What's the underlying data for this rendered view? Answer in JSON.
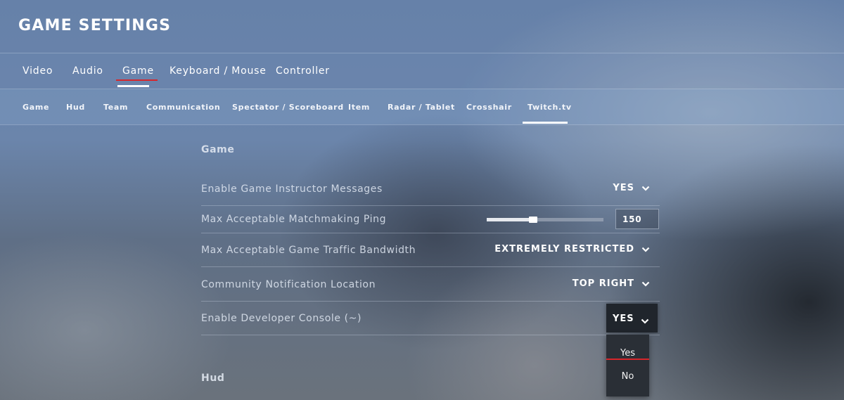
{
  "header": {
    "title": "GAME SETTINGS"
  },
  "main_tabs": [
    {
      "label": "Video"
    },
    {
      "label": "Audio"
    },
    {
      "label": "Game",
      "selected": true
    },
    {
      "label": "Keyboard / Mouse"
    },
    {
      "label": "Controller"
    }
  ],
  "sub_tabs": [
    {
      "label": "Game"
    },
    {
      "label": "Hud"
    },
    {
      "label": "Team"
    },
    {
      "label": "Communication"
    },
    {
      "label": "Spectator / Scoreboard"
    },
    {
      "label": "Item"
    },
    {
      "label": "Radar / Tablet"
    },
    {
      "label": "Crosshair"
    },
    {
      "label": "Twitch.tv",
      "selected": true
    }
  ],
  "sections": {
    "game": {
      "heading": "Game",
      "rows": [
        {
          "label": "Enable Game Instructor Messages",
          "value": "YES"
        },
        {
          "label": "Max Acceptable Matchmaking Ping",
          "value": "150",
          "slider_fraction": 0.4
        },
        {
          "label": "Max Acceptable Game Traffic Bandwidth",
          "value": "EXTREMELY RESTRICTED"
        },
        {
          "label": "Community Notification Location",
          "value": "TOP RIGHT"
        },
        {
          "label": "Enable Developer Console (~)",
          "value": "YES"
        }
      ]
    },
    "hud": {
      "heading": "Hud"
    }
  },
  "open_dropdown": {
    "options": [
      "Yes",
      "No"
    ],
    "selected": "Yes"
  },
  "colors": {
    "accent_red": "#d7262b",
    "dropdown_bg": "#20252c",
    "text_white": "#ffffff"
  },
  "icons": {
    "chevron": "chevron-down-icon"
  }
}
